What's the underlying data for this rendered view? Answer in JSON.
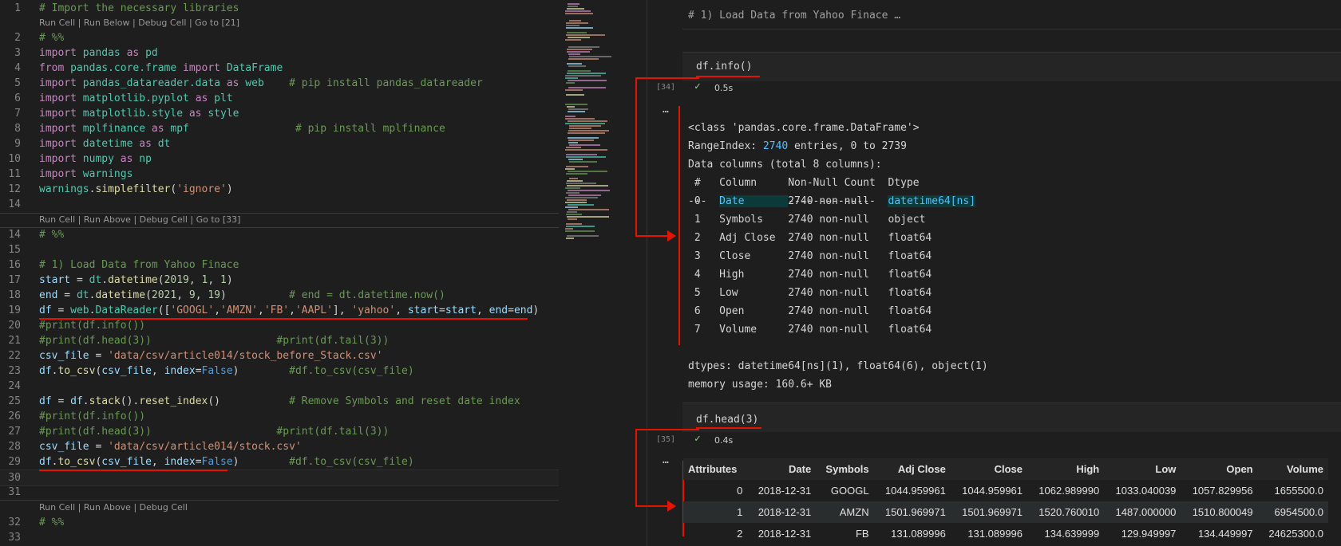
{
  "code_lens": {
    "cell1": "Run Cell | Run Below | Debug Cell | Go to [21]",
    "cell2": "Run Cell | Run Above | Debug Cell | Go to [33]",
    "cell3": "Run Cell | Run Above | Debug Cell"
  },
  "line_numbers": [
    "1",
    "2",
    "3",
    "4",
    "5",
    "6",
    "7",
    "8",
    "9",
    "10",
    "11",
    "12",
    "14",
    "15",
    "16",
    "17",
    "18",
    "19",
    "20",
    "21",
    "22",
    "23",
    "24",
    "25",
    "26",
    "27",
    "28",
    "29",
    "30",
    "31",
    "32",
    "33"
  ],
  "md_header": "# 1) Load Data from Yahoo Finace …",
  "cell_info": {
    "code": "df.info()",
    "count": "[34]",
    "time": "0.5s",
    "ellipsis": "…"
  },
  "cell_head": {
    "code": "df.head(3)",
    "count": "[35]",
    "time": "0.4s",
    "ellipsis": "…"
  },
  "info_output": {
    "class_line": "<class 'pandas.core.frame.DataFrame'>",
    "range_prefix": "RangeIndex: ",
    "range_num": "2740",
    "range_suffix": " entries, 0 to 2739",
    "data_columns": "Data columns (total 8 columns):",
    "header": " #   Column     Non-Null Count  Dtype",
    "dashes": "---  ------     --------------  -----",
    "rows": [
      {
        "idx": "0",
        "col": "Date",
        "count": "2740 non-null",
        "dtype": "datetime64[ns]"
      },
      {
        "idx": "1",
        "col": "Symbols",
        "count": "2740 non-null",
        "dtype": "object"
      },
      {
        "idx": "2",
        "col": "Adj Close",
        "count": "2740 non-null",
        "dtype": "float64"
      },
      {
        "idx": "3",
        "col": "Close",
        "count": "2740 non-null",
        "dtype": "float64"
      },
      {
        "idx": "4",
        "col": "High",
        "count": "2740 non-null",
        "dtype": "float64"
      },
      {
        "idx": "5",
        "col": "Low",
        "count": "2740 non-null",
        "dtype": "float64"
      },
      {
        "idx": "6",
        "col": "Open",
        "count": "2740 non-null",
        "dtype": "float64"
      },
      {
        "idx": "7",
        "col": "Volume",
        "count": "2740 non-null",
        "dtype": "float64"
      }
    ],
    "dtypes": "dtypes: datetime64[ns](1), float64(6), object(1)",
    "memory": "memory usage: 160.6+ KB"
  },
  "table": {
    "headers": [
      "Attributes",
      "Date",
      "Symbols",
      "Adj Close",
      "Close",
      "High",
      "Low",
      "Open",
      "Volume"
    ],
    "rows": [
      [
        "0",
        "2018-12-31",
        "GOOGL",
        "1044.959961",
        "1044.959961",
        "1062.989990",
        "1033.040039",
        "1057.829956",
        "1655500.0"
      ],
      [
        "1",
        "2018-12-31",
        "AMZN",
        "1501.969971",
        "1501.969971",
        "1520.760010",
        "1487.000000",
        "1510.800049",
        "6954500.0"
      ],
      [
        "2",
        "2018-12-31",
        "FB",
        "131.089996",
        "131.089996",
        "134.639999",
        "129.949997",
        "134.449997",
        "24625300.0"
      ]
    ]
  },
  "colors": {
    "underline_red": "#e51400",
    "check_green": "#89d185",
    "editor_bg": "#1e1e1e"
  },
  "icons": {
    "check": "check-icon"
  },
  "check_glyph": "✓"
}
